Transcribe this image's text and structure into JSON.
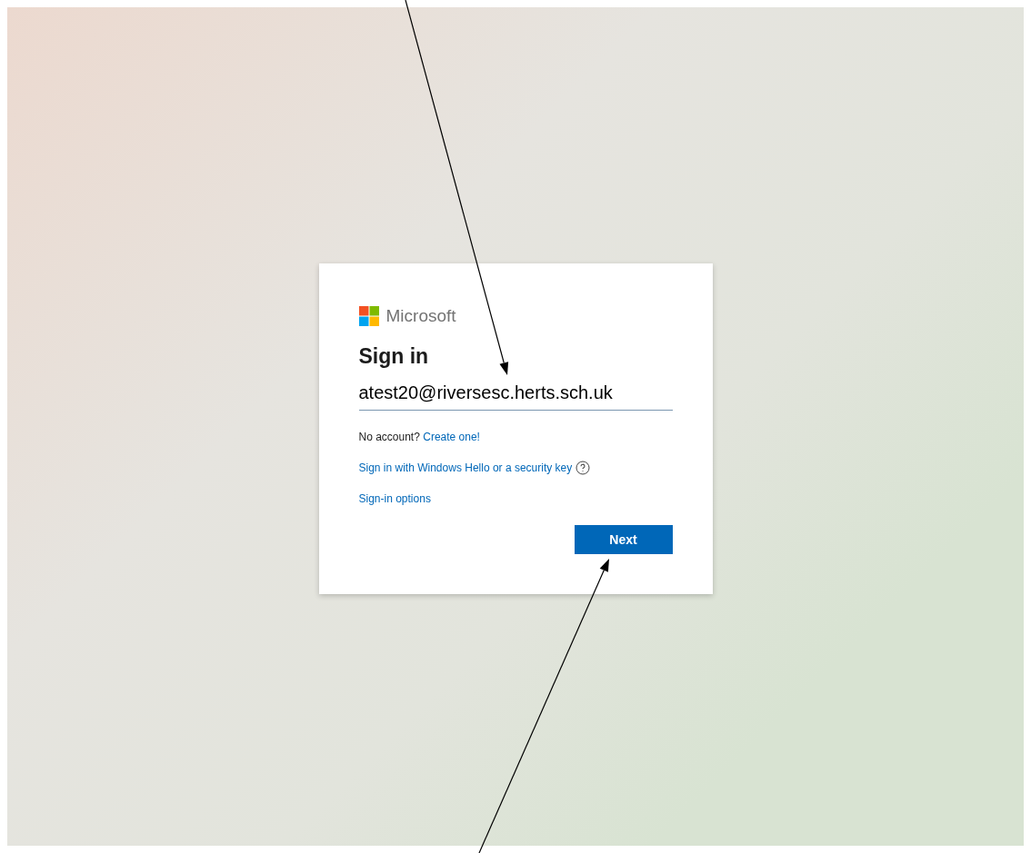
{
  "brand": {
    "name": "Microsoft"
  },
  "title": "Sign in",
  "email_field": {
    "value": "atest20@riversesc.herts.sch.uk"
  },
  "no_account": {
    "text": "No account?",
    "link": "Create one!"
  },
  "links": [
    {
      "label": "Sign in with Windows Hello or a security key",
      "has_help": true
    },
    {
      "label": "Sign-in options",
      "has_help": false
    }
  ],
  "buttons": [
    {
      "label": "Next"
    }
  ]
}
